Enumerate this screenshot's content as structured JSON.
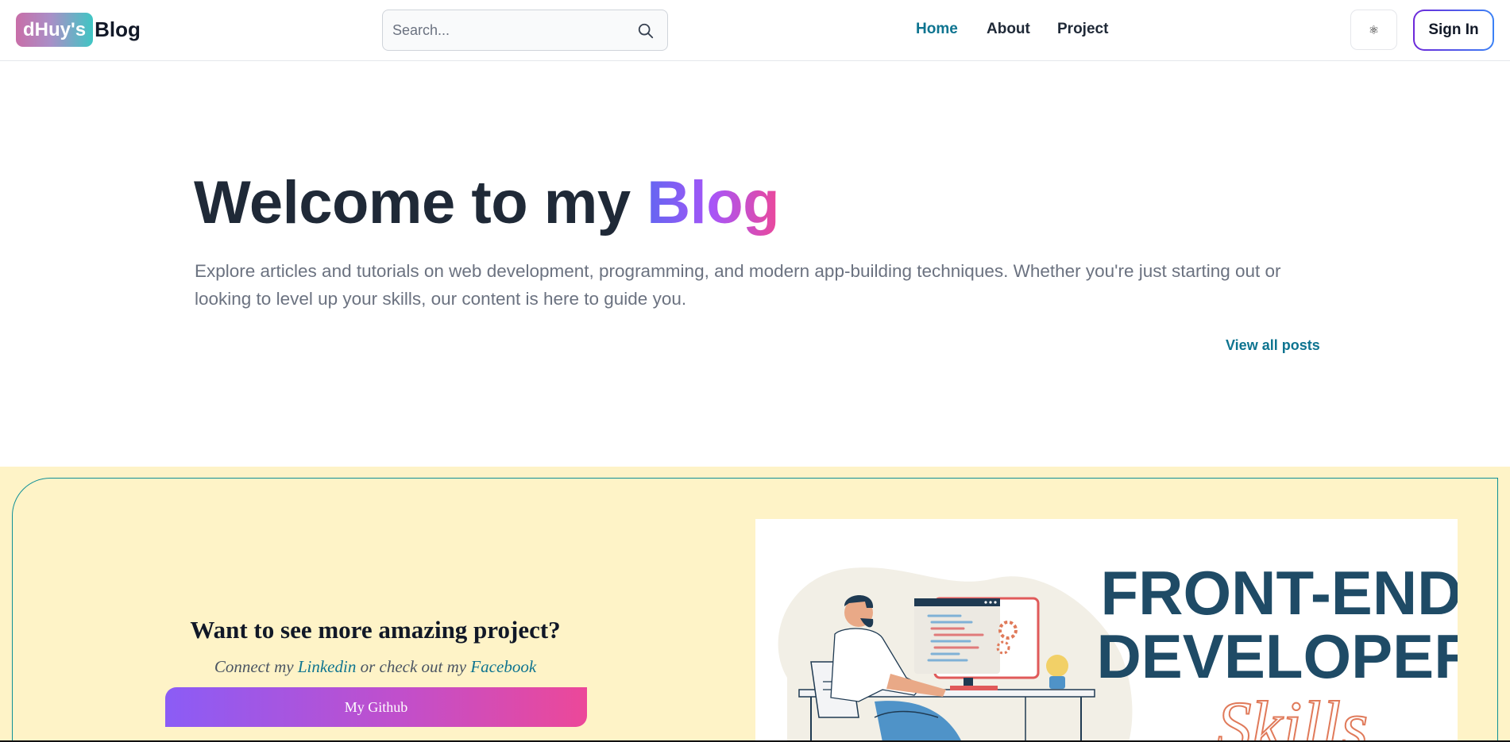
{
  "header": {
    "logo_badge": "dHuy's",
    "logo_text": "Blog",
    "search_placeholder": "Search...",
    "nav": [
      {
        "label": "Home",
        "active": true
      },
      {
        "label": "About",
        "active": false
      },
      {
        "label": "Project",
        "active": false
      }
    ],
    "theme_icon": "⚛",
    "sign_in_label": "Sign In"
  },
  "hero": {
    "title_prefix": "Welcome to my ",
    "title_accent": "Blog",
    "description": "Explore articles and tutorials on web development, programming, and modern app-building techniques. Whether you're just starting out or looking to level up your skills, our content is here to guide you.",
    "view_all_label": "View all posts"
  },
  "promo": {
    "heading": "Want to see more amazing project?",
    "sub_prefix": "Connect my ",
    "linkedin_label": "Linkedin",
    "sub_middle": " or check out my ",
    "facebook_label": "Facebook",
    "github_label": "My Github",
    "image": {
      "line1": "FRONT-END",
      "line2": "DEVELOPER",
      "line3": "Skills"
    }
  },
  "colors": {
    "accent_teal": "#0e7490",
    "promo_bg": "#fef3c7",
    "gradient_start": "#8b5cf6",
    "gradient_end": "#ec4899"
  }
}
